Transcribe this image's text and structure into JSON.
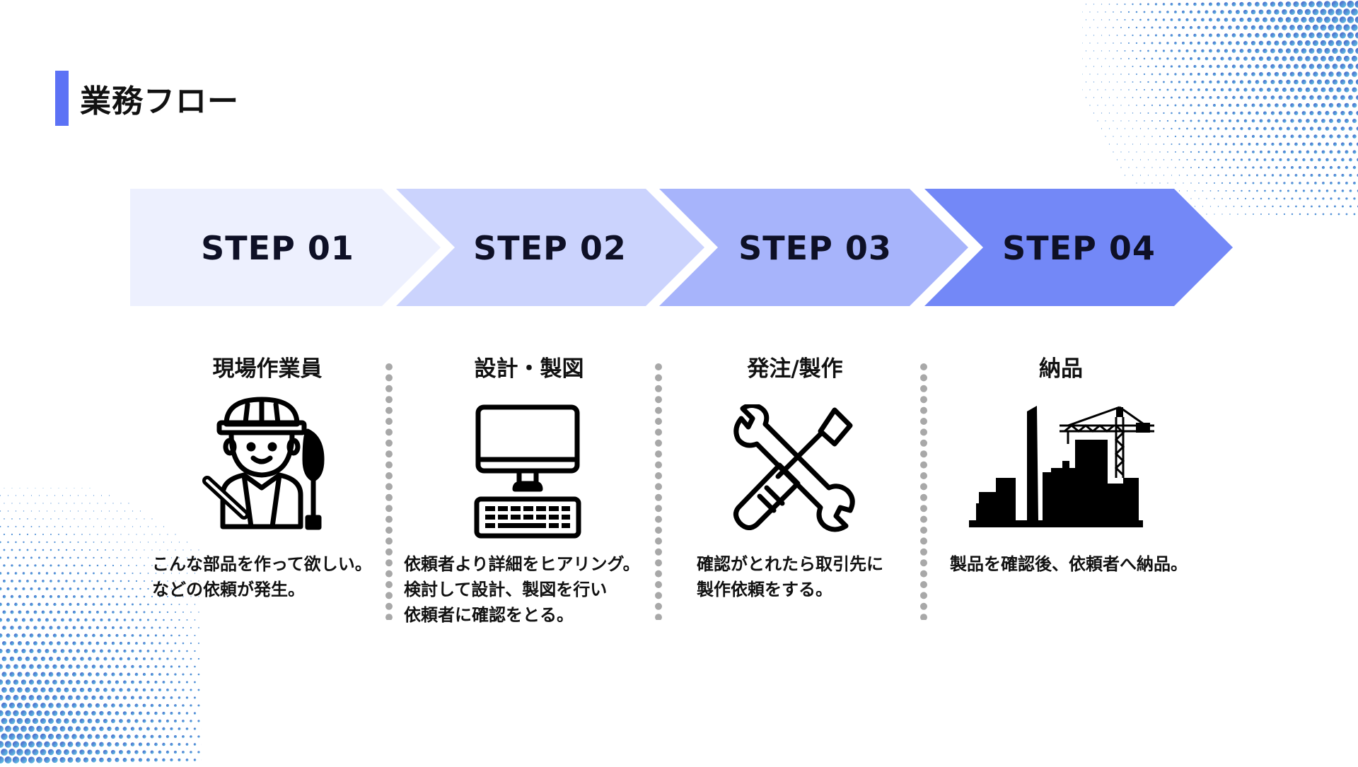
{
  "title": "業務フロー",
  "colors": {
    "accent": "#5c72f5",
    "step1": "#edf0fe",
    "step2": "#cbd3fd",
    "step3": "#a7b4fb",
    "step4": "#7388f7",
    "divider_dots": "#a8a8a8"
  },
  "steps": [
    {
      "label": "STEP 01",
      "heading": "現場作業員",
      "icon": "construction-worker-icon",
      "description": [
        "こんな部品を作って欲しい。",
        "などの依頼が発生。"
      ]
    },
    {
      "label": "STEP 02",
      "heading": "設計・製図",
      "icon": "desktop-computer-icon",
      "description": [
        "依頼者より詳細をヒアリング。",
        "検討して設計、製図を行い",
        "依頼者に確認をとる。"
      ]
    },
    {
      "label": "STEP 03",
      "heading": "発注/製作",
      "icon": "wrench-screwdriver-icon",
      "description": [
        "確認がとれたら取引先に",
        "製作依頼をする。"
      ]
    },
    {
      "label": "STEP 04",
      "heading": "納品",
      "icon": "city-construction-icon",
      "description": [
        "製品を確認後、依頼者へ納品。"
      ]
    }
  ]
}
